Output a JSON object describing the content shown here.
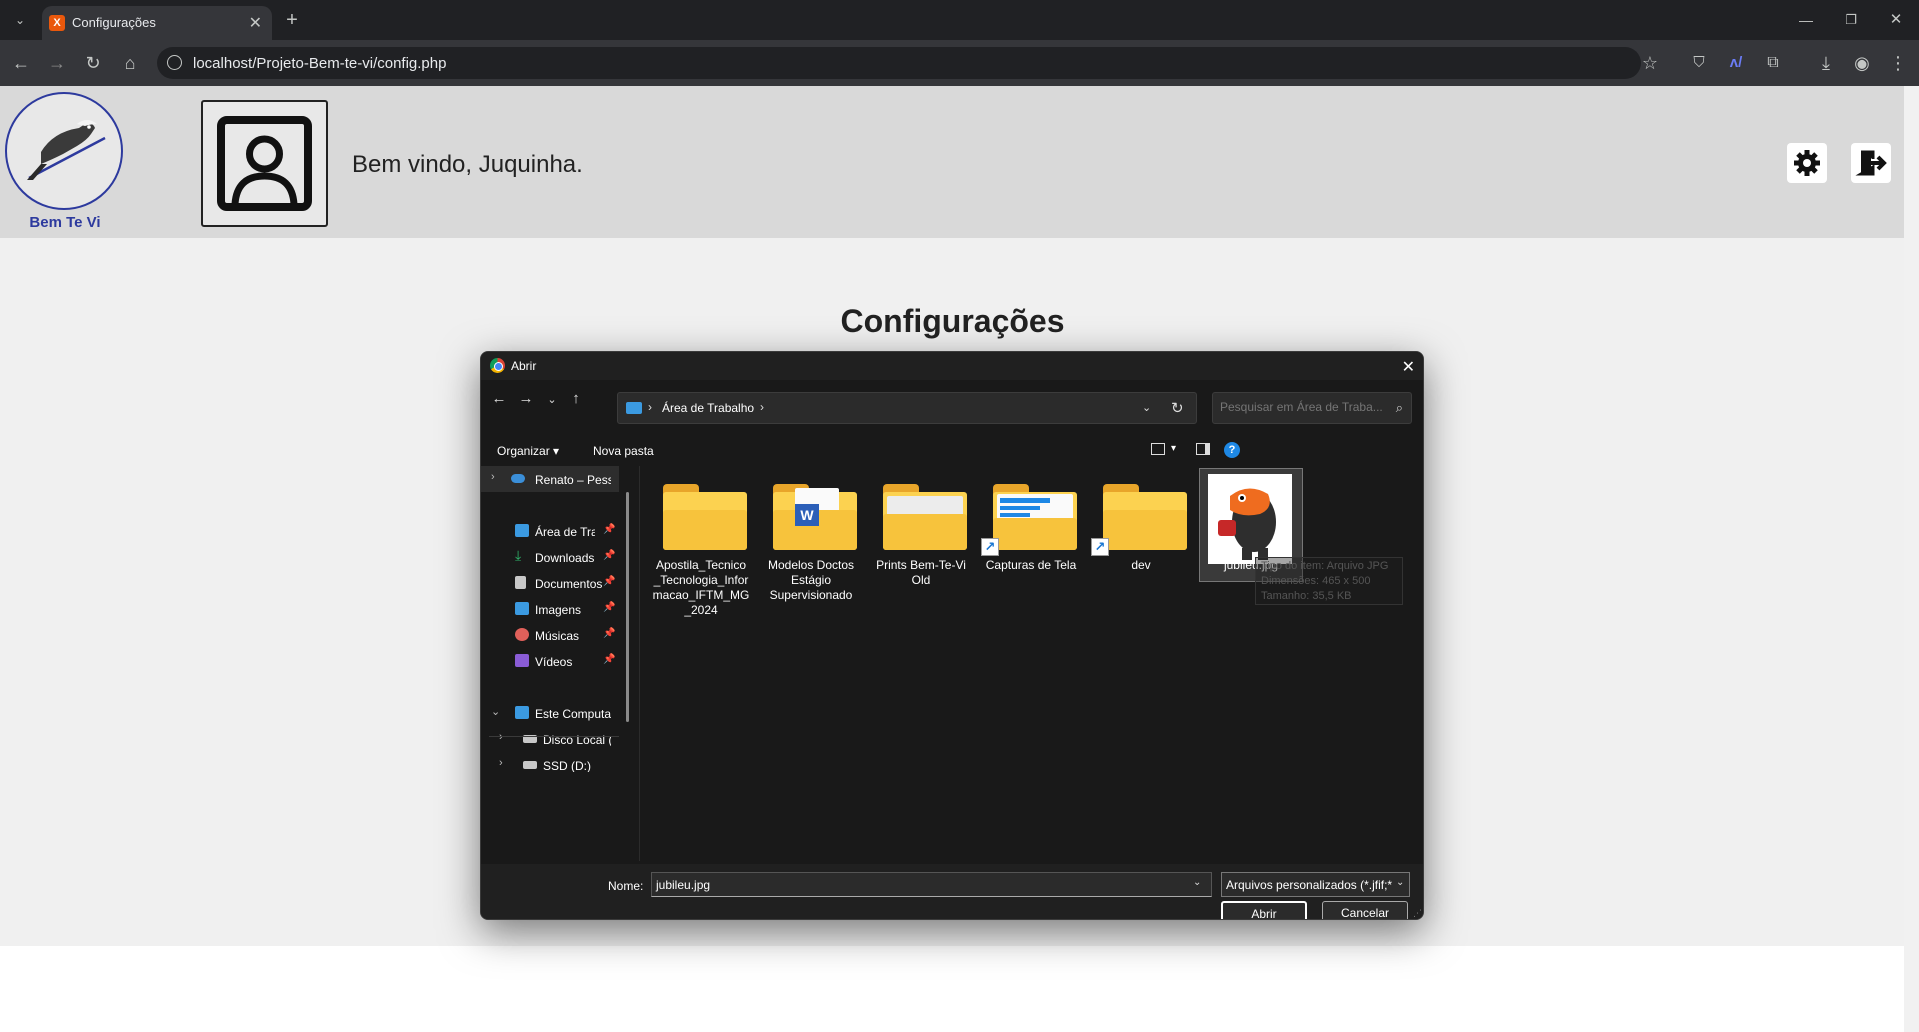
{
  "browser": {
    "tab_title": "Configurações",
    "url": "localhost/Projeto-Bem-te-vi/config.php"
  },
  "site": {
    "logo_text": "Bem Te Vi",
    "welcome": "Bem vindo, Juquinha.",
    "page_title": "Configurações"
  },
  "dialog": {
    "title": "Abrir",
    "address": "Área de Trabalho",
    "search_placeholder": "Pesquisar em Área de Traba...",
    "organize": "Organizar",
    "new_folder": "Nova pasta",
    "nav_items": [
      {
        "label": "Renato – Pessoal",
        "icon": "cloud-icon",
        "color": "#3b8fd9"
      },
      {
        "label": "Área de Trabalho",
        "icon": "desktop-icon",
        "color": "#3b9ae1"
      },
      {
        "label": "Downloads",
        "icon": "download-icon",
        "color": "#2fb56b"
      },
      {
        "label": "Documentos",
        "icon": "document-icon",
        "color": "#c8c8c8"
      },
      {
        "label": "Imagens",
        "icon": "image-icon",
        "color": "#3b9ae1"
      },
      {
        "label": "Músicas",
        "icon": "music-icon",
        "color": "#e0605a"
      },
      {
        "label": "Vídeos",
        "icon": "video-icon",
        "color": "#8a5cd6"
      },
      {
        "label": "Este Computador",
        "icon": "computer-icon",
        "color": "#3b9ae1"
      },
      {
        "label": "Disco Local (C:)",
        "icon": "drive-icon",
        "color": "#c8c8c8"
      },
      {
        "label": "SSD (D:)",
        "icon": "drive-icon",
        "color": "#c8c8c8"
      }
    ],
    "files": [
      {
        "name": "Apostila_Tecnico_Tecnologia_Informacao_IFTM_MG_2024",
        "label_lines": [
          "Apostila_Tecnico",
          "_Tecnologia_Infor",
          "macao_IFTM_MG",
          "_2024"
        ]
      },
      {
        "name": "Modelos Doctos Estágio Supervisionado",
        "label_lines": [
          "Modelos Doctos",
          "Estágio",
          "Supervisionado"
        ]
      },
      {
        "name": "Prints Bem-Te-Vi Old",
        "label_lines": [
          "Prints Bem-Te-Vi",
          "Old"
        ]
      },
      {
        "name": "Capturas de Tela",
        "label_lines": [
          "Capturas de Tela"
        ]
      },
      {
        "name": "dev",
        "label_lines": [
          "dev"
        ]
      },
      {
        "name": "jubileu.jpg",
        "label_lines": [
          "jubileu.jpg"
        ]
      }
    ],
    "tooltip": [
      "Tipo do item: Arquivo JPG",
      "Dimensões: 465 x 500",
      "Tamanho: 35,5 KB"
    ],
    "name_label": "Nome:",
    "name_value": "jubileu.jpg",
    "file_type": "Arquivos personalizados (*.jfif;*",
    "open_button": "Abrir",
    "cancel_button": "Cancelar"
  }
}
